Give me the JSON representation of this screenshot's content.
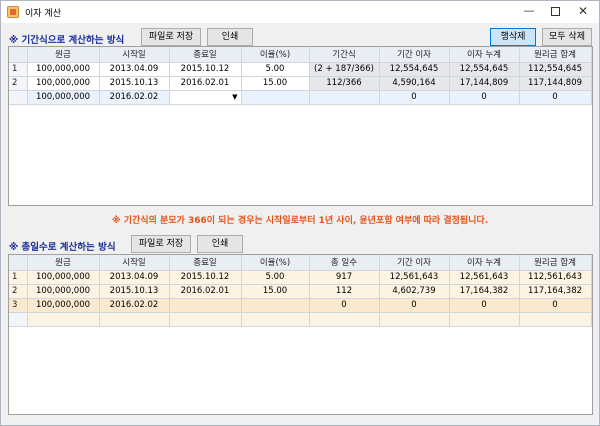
{
  "window": {
    "title": "이자 계산",
    "min": "—",
    "close": "✕"
  },
  "section1": {
    "title": "※ 기간식으로 계산하는 방식",
    "save_label": "파일로 저장",
    "print_label": "인쇄",
    "delete_row_label": "행삭제",
    "delete_all_label": "모두 삭제",
    "columns": [
      "원금",
      "시작일",
      "종료일",
      "이율(%)",
      "기간식",
      "기간 이자",
      "이자 누계",
      "원리금 합계"
    ],
    "rows": [
      {
        "no": "1",
        "cells": [
          "100,000,000",
          "2013.04.09",
          "2015.10.12",
          "5.00",
          "(2 + 187/366)",
          "12,554,645",
          "12,554,645",
          "112,554,645"
        ]
      },
      {
        "no": "2",
        "cells": [
          "100,000,000",
          "2015.10.13",
          "2016.02.01",
          "15.00",
          "112/366",
          "4,590,164",
          "17,144,809",
          "117,144,809"
        ]
      },
      {
        "no": "",
        "cells": [
          "100,000,000",
          "2016.02.02",
          "",
          "",
          "",
          "0",
          "0",
          "0"
        ]
      }
    ]
  },
  "notice": "※ 기간식의 분모가 366이 되는 경우는 시작일로부터 1년 사이, 윤년포함 여부에 따라 결정됩니다.",
  "section2": {
    "title": "※ 총일수로 계산하는 방식",
    "save_label": "파일로 저장",
    "print_label": "인쇄",
    "columns": [
      "원금",
      "시작일",
      "종료일",
      "이율(%)",
      "총 일수",
      "기간 이자",
      "이자 누계",
      "원리금 합계"
    ],
    "rows": [
      {
        "no": "1",
        "cells": [
          "100,000,000",
          "2013.04.09",
          "2015.10.12",
          "5.00",
          "917",
          "12,561,643",
          "12,561,643",
          "112,561,643"
        ]
      },
      {
        "no": "2",
        "cells": [
          "100,000,000",
          "2015.10.13",
          "2016.02.01",
          "15.00",
          "112",
          "4,602,739",
          "17,164,382",
          "117,164,382"
        ]
      },
      {
        "no": "3",
        "cells": [
          "100,000,000",
          "2016.02.02",
          "",
          "",
          "0",
          "0",
          "0",
          "0"
        ]
      }
    ]
  },
  "colors": {
    "section_title": "#1c2f9a",
    "notice": "#e0541a",
    "accent": "#0078d7"
  },
  "icons": {
    "dropdown": "chevron-down-icon",
    "app": "calculator-app-icon"
  }
}
